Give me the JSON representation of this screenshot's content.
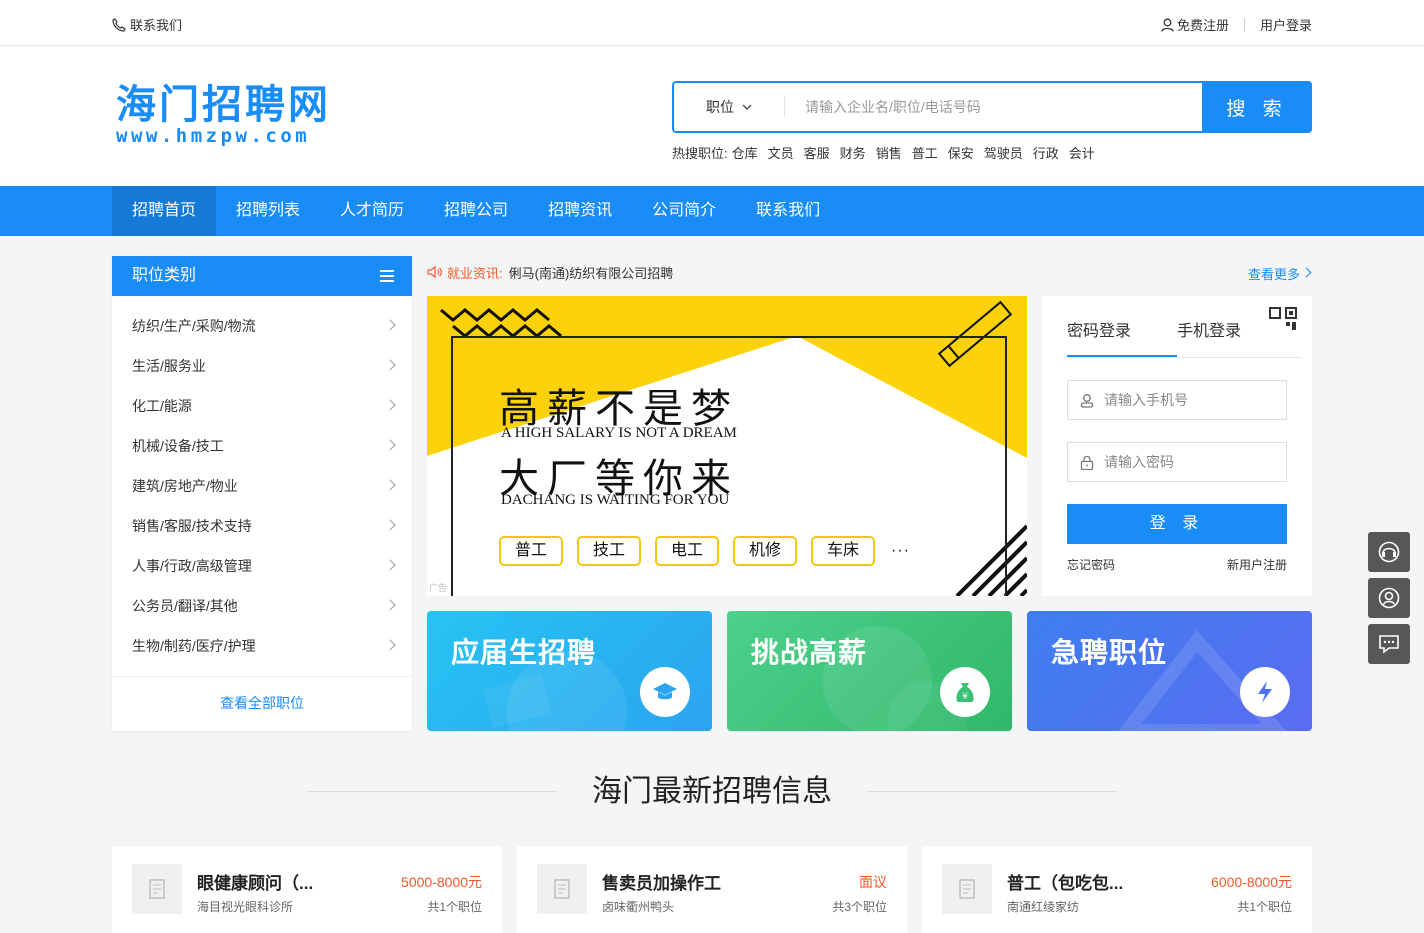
{
  "topbar": {
    "contact": "联系我们",
    "register": "免费注册",
    "login": "用户登录"
  },
  "logo": {
    "cn": "海门招聘网",
    "en": "www.hmzpw.com"
  },
  "search": {
    "category": "职位",
    "placeholder": "请输入企业名/职位/电话号码",
    "button": "搜 索"
  },
  "hot": {
    "label": "热搜职位:",
    "items": [
      "仓库",
      "文员",
      "客服",
      "财务",
      "销售",
      "普工",
      "保安",
      "驾驶员",
      "行政",
      "会计"
    ]
  },
  "nav": [
    "招聘首页",
    "招聘列表",
    "人才简历",
    "招聘公司",
    "招聘资讯",
    "公司简介",
    "联系我们"
  ],
  "sidebar": {
    "title": "职位类别",
    "items": [
      "纺织/生产/采购/物流",
      "生活/服务业",
      "化工/能源",
      "机械/设备/技工",
      "建筑/房地产/物业",
      "销售/客服/技术支持",
      "人事/行政/高级管理",
      "公务员/翻译/其他",
      "生物/制药/医疗/护理"
    ],
    "all": "查看全部职位"
  },
  "news": {
    "label": "就业资讯:",
    "text": "俐马(南通)纺织有限公司招聘",
    "more": "查看更多"
  },
  "banner": {
    "line1": "高薪不是梦",
    "line1_en": "A HIGH SALARY IS NOT A DREAM",
    "line2": "大厂等你来",
    "line2_en": "DACHANG IS WAITING FOR YOU",
    "tags": [
      "普工",
      "技工",
      "电工",
      "机修",
      "车床"
    ],
    "more": "···",
    "ad": "广告",
    "colors": {
      "yellow": "#fcd30a"
    }
  },
  "login": {
    "tab_password": "密码登录",
    "tab_phone": "手机登录",
    "phone_placeholder": "请输入手机号",
    "password_placeholder": "请输入密码",
    "button": "登 录",
    "forgot": "忘记密码",
    "register": "新用户注册"
  },
  "promos": [
    "应届生招聘",
    "挑战高薪",
    "急聘职位"
  ],
  "section": {
    "title": "海门最新招聘信息"
  },
  "jobs": [
    {
      "name": "眼健康顾问（...",
      "salary": "5000-8000元",
      "company": "海目视光眼科诊所",
      "count": "共1个职位"
    },
    {
      "name": "售卖员加操作工",
      "salary": "面议",
      "company": "卤味衢州鸭头",
      "count": "共3个职位"
    },
    {
      "name": "普工（包吃包...",
      "salary": "6000-8000元",
      "company": "南通红绫家纺",
      "count": "共1个职位"
    }
  ],
  "theme": {
    "primary": "#1a8cf5",
    "accent": "#f05a2a"
  }
}
